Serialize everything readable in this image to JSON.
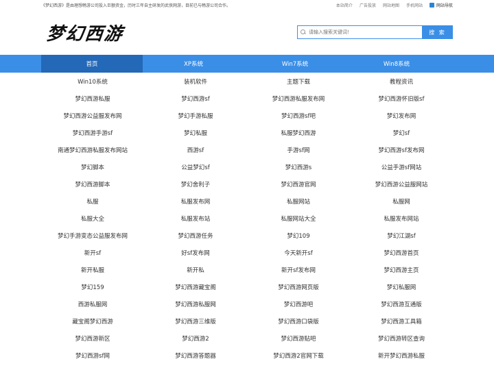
{
  "topbar": {
    "notice": "《梦幻西游》是由理想畅游公司投入巨额资金，历时三年自主研发的武侠网游，目前已与畅游公司合作。",
    "links": [
      "本站简介",
      "广告投放",
      "网站地图",
      "手机网站"
    ],
    "site_nav": "网站导航"
  },
  "header": {
    "logo": "梦幻西游",
    "search_placeholder": "请输入搜索关键词！",
    "search_button": "搜 索"
  },
  "nav": {
    "items": [
      "首页",
      "XP系统",
      "Win7系统",
      "Win8系统"
    ],
    "active_index": 0
  },
  "links": [
    "Win10系统",
    "装机软件",
    "主题下载",
    "教程资讯",
    "梦幻西游私服",
    "梦幻西游sf",
    "梦幻西游私服发布网",
    "梦幻西游怀旧版sf",
    "梦幻西游公益服发布网",
    "梦幻手游私服",
    "梦幻西游sf吧",
    "梦幻发布网",
    "梦幻西游手游sf",
    "梦幻私服",
    "私服梦幻西游",
    "梦幻sf",
    "南通梦幻西游私服发布网站",
    "西游sf",
    "手游sf网",
    "梦幻西游sf发布网",
    "梦幻脚本",
    "公益梦幻sf",
    "梦幻西游s",
    "公益手游sf网站",
    "梦幻西游脚本",
    "梦幻舍利子",
    "梦幻西游官网",
    "梦幻西游公益服网站",
    "私服",
    "私服发布网",
    "私服网站",
    "私服网",
    "私服大全",
    "私服发布站",
    "私服网站大全",
    "私服发布网站",
    "梦幻手游变态公益服发布网",
    "梦幻西游任务",
    "梦幻109",
    "梦幻江湖sf",
    "新开sf",
    "好sf发布网",
    "今天新开sf",
    "梦幻西游首页",
    "新开私服",
    "新开私",
    "新开sf发布网",
    "梦幻西游主页",
    "梦幻159",
    "梦幻西游藏宝阁",
    "梦幻西游网页版",
    "梦幻私服网",
    "西游私服网",
    "梦幻西游私服网",
    "梦幻西游吧",
    "梦幻西游互通版",
    "藏宝阁梦幻西游",
    "梦幻西游三维版",
    "梦幻西游口袋版",
    "梦幻西游工具箱",
    "梦幻西游新区",
    "梦幻西游2",
    "梦幻西游贴吧",
    "梦幻西游转区查询",
    "梦幻西游sf网",
    "梦幻西游答题器",
    "梦幻西游2官网下载",
    "新开梦幻西游私服"
  ],
  "colors": {
    "accent": "#3a8ee6",
    "nav_active": "#2468b8"
  }
}
